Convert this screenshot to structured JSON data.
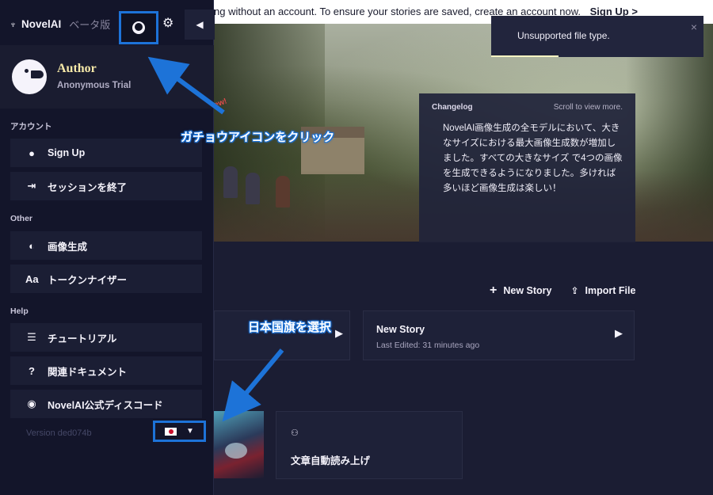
{
  "top_banner": {
    "message": "ng without an account. To ensure your stories are saved, create an account now.",
    "link": "Sign Up >"
  },
  "toast": {
    "text": "Unsupported file type.",
    "close": "×"
  },
  "hero": {
    "bubble": "ew!"
  },
  "changelog": {
    "title": "Changelog",
    "hint": "Scroll to view more.",
    "body": "NovelAI画像生成の全モデルにおいて、大きなサイズにおける最大画像生成数が増加しました。すべての大きなサイズ で4つの画像を生成できるようになりました。多ければ多いほど画像生成は楽しい！"
  },
  "actions": {
    "new_story": "New Story",
    "import_file": "Import File"
  },
  "story_card": {
    "title": "New Story",
    "subtitle": "Last Edited: 31 minutes ago"
  },
  "tts_card": {
    "label": "文章自動読み上げ"
  },
  "sidebar": {
    "logo_text": "NovelAI",
    "beta_label": "ベータ版",
    "profile": {
      "name": "Author",
      "subtitle": "Anonymous Trial"
    },
    "sections": {
      "account": "アカウント",
      "other": "Other",
      "help": "Help"
    },
    "buttons": {
      "sign_up": "Sign Up",
      "end_session": "セッションを終了",
      "image_gen": "画像生成",
      "tokenizer": "トークンナイザー",
      "tutorial": "チュートリアル",
      "docs": "関連ドキュメント",
      "discord": "NovelAI公式ディスコード"
    },
    "version": "Version ded074b"
  },
  "annotations": {
    "goose_hint": "ガチョウアイコンをクリック",
    "flag_hint": "日本国旗を選択",
    "accent_color": "#1d73d8"
  },
  "icons": {
    "goose": "goose-icon",
    "gear": "gear-icon",
    "collapse": "chevron-left-icon",
    "user": "user-icon",
    "logout": "logout-icon",
    "palette": "palette-icon",
    "text": "text-size-icon",
    "tutorial": "list-icon",
    "question": "question-icon",
    "discord": "discord-icon",
    "flag": "japan-flag-icon",
    "plus": "plus-icon",
    "import": "import-icon",
    "tts": "speech-icon"
  }
}
